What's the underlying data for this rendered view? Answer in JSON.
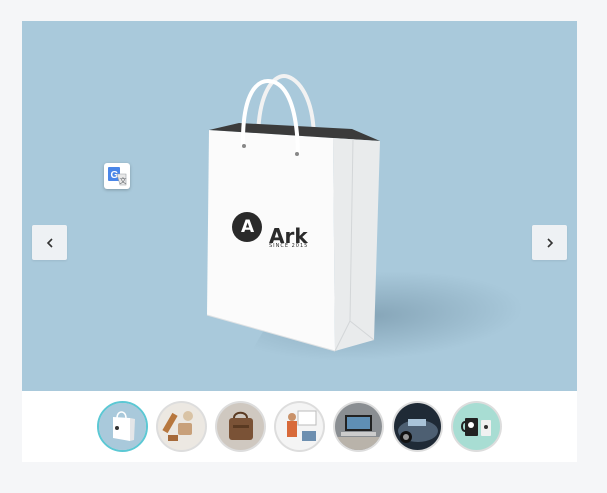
{
  "bag": {
    "logo_letter": "A",
    "brand_name": "Ark",
    "brand_tagline": "SINCE 2015"
  },
  "navigation": {
    "prev_icon": "chevron-left-icon",
    "next_icon": "chevron-right-icon"
  },
  "thumbnails": [
    {
      "name": "thumbnail-shopping-bag",
      "active": true
    },
    {
      "name": "thumbnail-craft-items",
      "active": false
    },
    {
      "name": "thumbnail-leather-bag",
      "active": false
    },
    {
      "name": "thumbnail-presentation",
      "active": false
    },
    {
      "name": "thumbnail-laptop-desk",
      "active": false
    },
    {
      "name": "thumbnail-car",
      "active": false
    },
    {
      "name": "thumbnail-mugs",
      "active": false
    }
  ],
  "colors": {
    "stage_background": "#a9c9db",
    "active_thumb_border": "#5bc8d4"
  }
}
